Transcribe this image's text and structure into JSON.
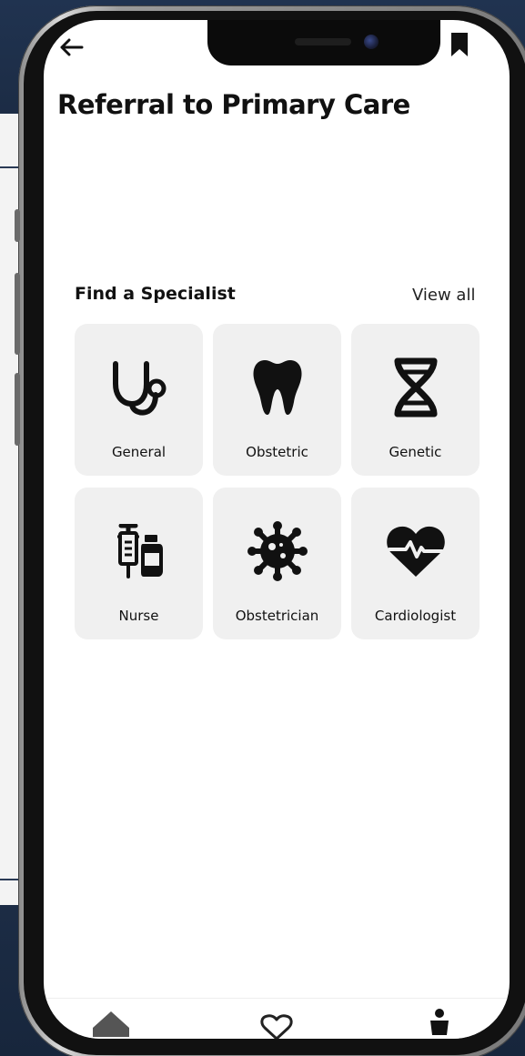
{
  "header": {
    "title": "Referral to Primary Care",
    "back_icon": "arrow-left-icon",
    "bookmark_icon": "bookmark-icon"
  },
  "specialists": {
    "section_title": "Find a Specialist",
    "view_all_label": "View all",
    "items": [
      {
        "label": "General",
        "icon": "stethoscope-icon"
      },
      {
        "label": "Obstetric",
        "icon": "tooth-icon"
      },
      {
        "label": "Genetic",
        "icon": "dna-icon"
      },
      {
        "label": "Nurse",
        "icon": "syringe-vial-icon"
      },
      {
        "label": "Obstetrician",
        "icon": "virus-icon"
      },
      {
        "label": "Cardiologist",
        "icon": "heart-pulse-icon"
      }
    ]
  },
  "bottom_nav": {
    "items": [
      {
        "icon": "home-icon"
      },
      {
        "icon": "heart-outline-icon"
      },
      {
        "icon": "person-icon"
      }
    ]
  },
  "colors": {
    "background_dark": "#1a2a40",
    "card_background": "#f0f0f0",
    "text_primary": "#111111",
    "screen_background": "#ffffff"
  }
}
